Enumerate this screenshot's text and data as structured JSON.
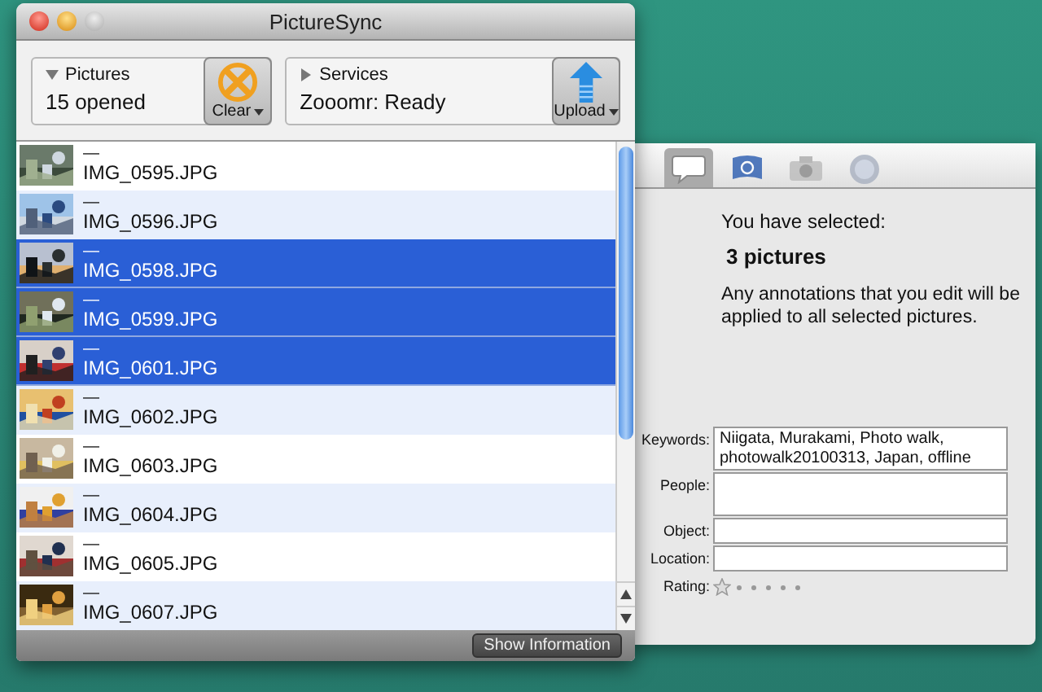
{
  "window": {
    "title": "PictureSync"
  },
  "pictures": {
    "label": "Pictures",
    "summary": "15 opened",
    "expanded": true
  },
  "clear_button": {
    "label": "Clear"
  },
  "services": {
    "label": "Services",
    "summary": "Zooomr: Ready",
    "expanded": false
  },
  "upload_button": {
    "label": "Upload"
  },
  "files": [
    {
      "title": "—",
      "name": "IMG_0595.JPG",
      "selected": false
    },
    {
      "title": "—",
      "name": "IMG_0596.JPG",
      "selected": false
    },
    {
      "title": "—",
      "name": "IMG_0598.JPG",
      "selected": true
    },
    {
      "title": "—",
      "name": "IMG_0599.JPG",
      "selected": true
    },
    {
      "title": "—",
      "name": "IMG_0601.JPG",
      "selected": true
    },
    {
      "title": "—",
      "name": "IMG_0602.JPG",
      "selected": false
    },
    {
      "title": "—",
      "name": "IMG_0603.JPG",
      "selected": false
    },
    {
      "title": "—",
      "name": "IMG_0604.JPG",
      "selected": false
    },
    {
      "title": "—",
      "name": "IMG_0605.JPG",
      "selected": false
    },
    {
      "title": "—",
      "name": "IMG_0607.JPG",
      "selected": false
    }
  ],
  "show_information_button": {
    "label": "Show Information"
  },
  "inspector": {
    "tabs": [
      {
        "kind": "annotations",
        "selected": true
      },
      {
        "kind": "flag",
        "selected": false
      },
      {
        "kind": "camera",
        "selected": false
      },
      {
        "kind": "globe",
        "selected": false
      }
    ],
    "selection_label": "You have selected:",
    "selection_count": "3 pictures",
    "note": "Any annotations that you edit will be applied to all selected pictures.",
    "fields": [
      {
        "label": "Keywords:",
        "value": "Niigata, Murakami, Photo walk, photowalk20100313, Japan, offline",
        "kind": "tall"
      },
      {
        "label": "People:",
        "kind": "tall"
      },
      {
        "label": "Object:",
        "kind": "short"
      },
      {
        "label": "Location:",
        "kind": "short"
      }
    ],
    "rating": {
      "label": "Rating:",
      "stars": 0
    }
  }
}
